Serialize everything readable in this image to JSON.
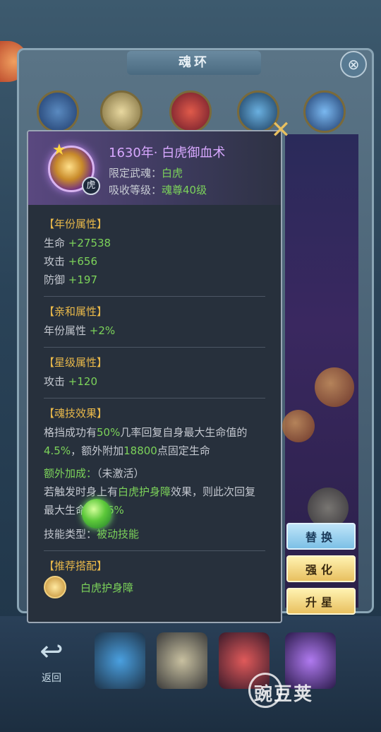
{
  "background": {
    "window_title": "魂环",
    "side_buttons": [
      "替换",
      "强化",
      "升星"
    ],
    "back_label": "返回"
  },
  "popup": {
    "title": "1630年· 白虎御血术",
    "meta": [
      {
        "label": "限定武魂：",
        "value": "白虎"
      },
      {
        "label": "吸收等级：",
        "value": "魂尊40级"
      }
    ],
    "sections": {
      "year_attr": {
        "title": "【年份属性】",
        "rows": [
          {
            "label": "生命",
            "value": "+27538"
          },
          {
            "label": "攻击",
            "value": "+656"
          },
          {
            "label": "防御",
            "value": "+197"
          }
        ]
      },
      "affinity_attr": {
        "title": "【亲和属性】",
        "rows": [
          {
            "label": "年份属性",
            "value": "+2%"
          }
        ]
      },
      "star_attr": {
        "title": "【星级属性】",
        "rows": [
          {
            "label": "攻击",
            "value": "+120"
          }
        ]
      },
      "skill_effect": {
        "title": "【魂技效果】",
        "p1": "格挡成功有",
        "p1_v1": "50%",
        "p2": "几率回复自身最大生命值的",
        "p2_v2": "4.5%",
        "p3": "，额外附加",
        "p3_v3": "18800",
        "p4": "点固定生命",
        "extra_label": "额外加成：",
        "extra_status": "（未激活）",
        "extra_p1": "若触发时身上有",
        "extra_highlight": "白虎护身障",
        "extra_p2": "效果，则此次回复最大生命值的",
        "extra_value": "6%",
        "type_label": "技能类型：",
        "type_value": "被动技能"
      },
      "recommend": {
        "title": "【推荐搭配】",
        "item": "白虎护身障"
      }
    }
  },
  "watermark": "豌豆荚",
  "colors": {
    "accent_gold": "#e8b84a",
    "value_green": "#7cd35a",
    "title_purple": "#d8a8ff"
  }
}
